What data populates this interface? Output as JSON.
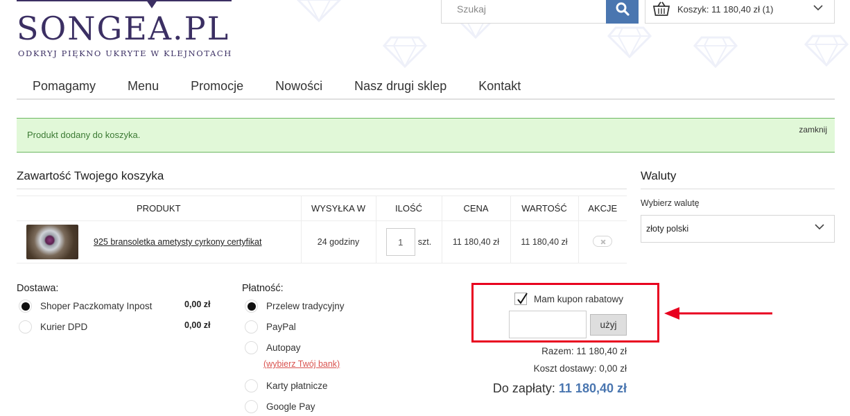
{
  "brand": {
    "title": "SONGEA.PL",
    "tagline": "ODKRYJ PIĘKNO UKRYTE W KLEJNOTACH",
    "color": "#3b2f63"
  },
  "search": {
    "placeholder": "Szukaj",
    "button_icon": "search-icon"
  },
  "cart": {
    "label": "Koszyk: 11 180,40 zł (1)",
    "icon": "basket-icon"
  },
  "nav": {
    "items": [
      {
        "label": "Pomagamy"
      },
      {
        "label": "Menu"
      },
      {
        "label": "Promocje"
      },
      {
        "label": "Nowości"
      },
      {
        "label": "Nasz drugi sklep"
      },
      {
        "label": "Kontakt"
      }
    ]
  },
  "notice": {
    "text": "Produkt dodany do koszyka.",
    "close": "zamknij"
  },
  "basket": {
    "title": "Zawartość Twojego koszyka",
    "columns": [
      "PRODUKT",
      "WYSYŁKA W",
      "ILOŚĆ",
      "CENA",
      "WARTOŚĆ",
      "AKCJE"
    ],
    "rows": [
      {
        "product": "925 bransoletka ametysty cyrkony certyfikat",
        "shipping": "24 godziny",
        "qty": "1",
        "unit": "szt.",
        "price": "11 180,40 zł",
        "value": "11 180,40 zł"
      }
    ]
  },
  "currency": {
    "title": "Waluty",
    "label": "Wybierz walutę",
    "selected": "złoty polski"
  },
  "shipping": {
    "title": "Dostawa:",
    "options": [
      {
        "label": "Shoper Paczkomaty Inpost",
        "price": "0,00 zł",
        "selected": true
      },
      {
        "label": "Kurier DPD",
        "price": "0,00 zł",
        "selected": false
      }
    ]
  },
  "payment": {
    "title": "Płatność:",
    "options": [
      {
        "label": "Przelew tradycyjny",
        "selected": true
      },
      {
        "label": "PayPal",
        "selected": false
      },
      {
        "label": "Autopay",
        "selected": false
      },
      {
        "label": "Karty płatnicze",
        "selected": false
      },
      {
        "label": "Google Pay",
        "selected": false
      }
    ],
    "bank_link": "(wybierz Twój bank)"
  },
  "coupon": {
    "label": "Mam kupon rabatowy",
    "checked": true,
    "button": "użyj",
    "value": ""
  },
  "summary": {
    "subtotal": "Razem: 11 180,40 zł",
    "shipping_cost": "Koszt dostawy: 0,00 zł",
    "total_label": "Do zapłaty:",
    "total_value": "11 180,40 zł"
  },
  "colors": {
    "accent": "#4a76b0",
    "highlight": "#e8001f",
    "notice_bg": "#e1f8d8"
  }
}
